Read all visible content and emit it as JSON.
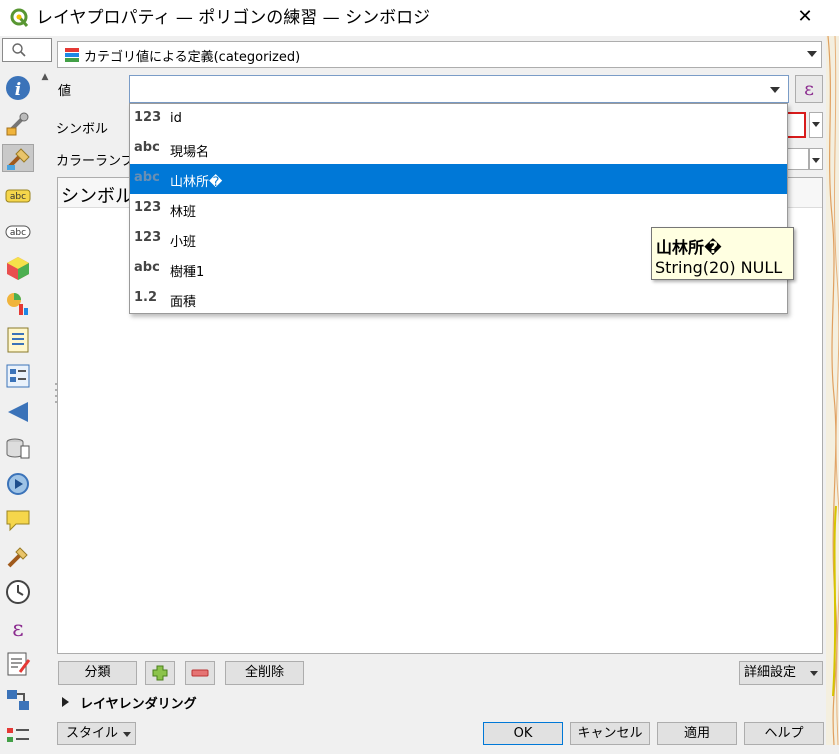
{
  "window": {
    "title": "レイヤプロパティ — ポリゴンの練習 — シンボロジ",
    "app_icon": "qgis-icon",
    "close_glyph": "✕"
  },
  "sidebar": {
    "items": [
      {
        "name": "information-icon"
      },
      {
        "name": "source-icon"
      },
      {
        "name": "symbology-icon",
        "selected": true
      },
      {
        "name": "labels-icon"
      },
      {
        "name": "masks-icon"
      },
      {
        "name": "3d-view-icon"
      },
      {
        "name": "diagrams-icon"
      },
      {
        "name": "fields-icon"
      },
      {
        "name": "attributes-form-icon"
      },
      {
        "name": "joins-icon"
      },
      {
        "name": "auxiliary-storage-icon"
      },
      {
        "name": "actions-icon"
      },
      {
        "name": "display-icon"
      },
      {
        "name": "rendering-icon"
      },
      {
        "name": "temporal-icon"
      },
      {
        "name": "variables-icon"
      },
      {
        "name": "metadata-icon"
      },
      {
        "name": "dependencies-icon"
      },
      {
        "name": "legend-icon"
      }
    ]
  },
  "renderer": {
    "selected": "カテゴリ値による定義(categorized)"
  },
  "form": {
    "value_label": "値",
    "value_current": "",
    "symbol_label": "シンボル",
    "ramp_label": "カラーランプ",
    "expression_glyph": "ε"
  },
  "class_list": {
    "header_symbol": "シンボル"
  },
  "field_dropdown": {
    "items": [
      {
        "type": "123",
        "name": "id"
      },
      {
        "type": "abc",
        "name": "現場名"
      },
      {
        "type": "abc",
        "name": "山林所�",
        "selected": true
      },
      {
        "type": "123",
        "name": "林班"
      },
      {
        "type": "123",
        "name": "小班"
      },
      {
        "type": "abc",
        "name": "樹種1"
      },
      {
        "type": "1.2",
        "name": "面積"
      }
    ]
  },
  "tooltip": {
    "field_name": "山林所�",
    "field_type": "String(20) NULL"
  },
  "buttons": {
    "classify": "分類",
    "add": "+",
    "remove": "−",
    "delete_all": "全削除",
    "advanced": "詳細設定",
    "layer_rendering": "レイヤレンダリング",
    "style": "スタイル",
    "ok": "OK",
    "cancel": "キャンセル",
    "apply": "適用",
    "help": "ヘルプ"
  },
  "colors": {
    "selection": "#0078d7",
    "tooltip_bg": "#ffffe1",
    "symbol_red": "#d81b1b",
    "expression_purple": "#8b2b8f"
  }
}
